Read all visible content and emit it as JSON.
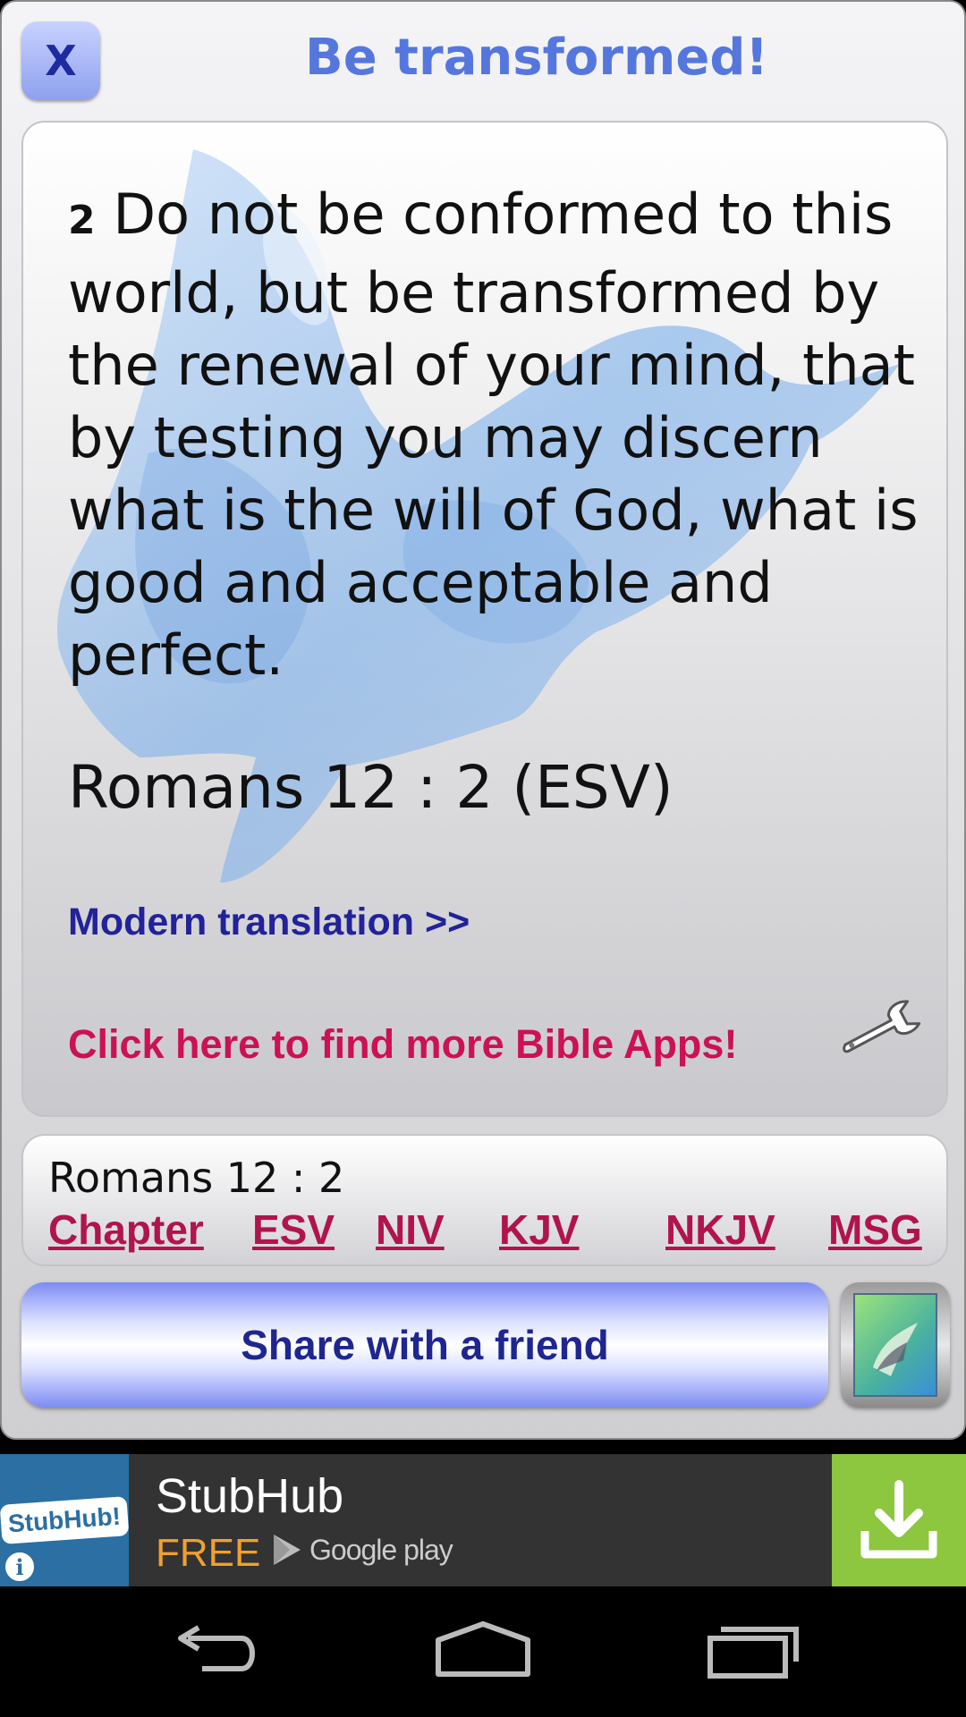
{
  "header": {
    "close_label": "X",
    "title": "Be transformed!"
  },
  "verse": {
    "number": "2",
    "text": "Do not be conformed to this world, but be transformed by the renewal of your mind, that by testing you may discern what is the will of God, what is good and acceptable and perfect.",
    "reference": "Romans 12 : 2  (ESV)",
    "modern_link": "Modern translation >>",
    "apps_link": "Click here to find more Bible Apps!",
    "settings_icon": "wrench-icon"
  },
  "links": {
    "reference": "Romans 12 : 2",
    "items": [
      "Chapter",
      "ESV",
      "NIV",
      "KJV",
      "NKJV",
      "MSG"
    ]
  },
  "share": {
    "label": "Share with a friend"
  },
  "ad": {
    "logo_text": "StubHub!",
    "app_name": "StubHub",
    "price": "FREE",
    "store": "Google play",
    "info_icon": "info-icon",
    "download_icon": "download-icon"
  },
  "navbar": {
    "icons": [
      "back-icon",
      "home-icon",
      "recents-icon"
    ]
  },
  "colors": {
    "title": "#5577dd",
    "link_blue": "#22229a",
    "link_red": "#cc1155",
    "ad_download": "#8dc63f",
    "ad_price": "#f0a030"
  }
}
